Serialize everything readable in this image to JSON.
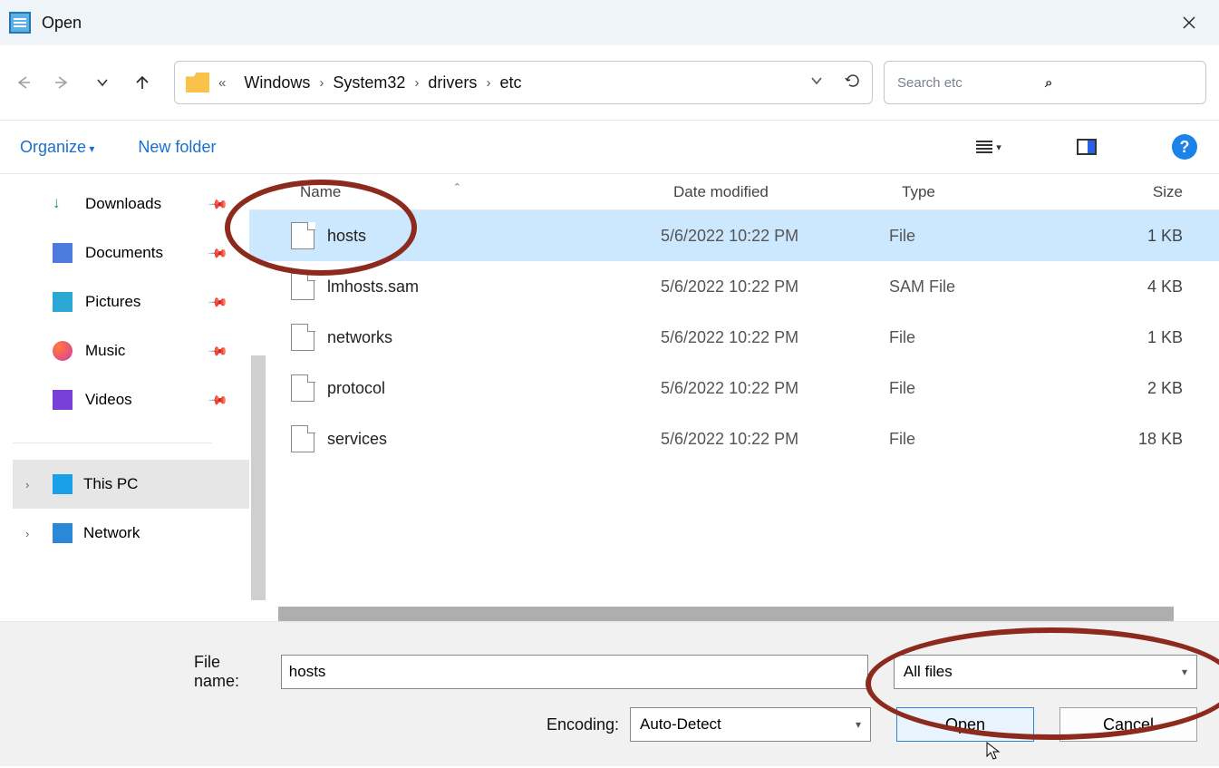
{
  "window": {
    "title": "Open"
  },
  "breadcrumbs": {
    "dots": "«",
    "items": [
      "Windows",
      "System32",
      "drivers",
      "etc"
    ]
  },
  "search": {
    "placeholder": "Search etc"
  },
  "cmdbar": {
    "organize": "Organize",
    "newfolder": "New folder"
  },
  "sidebar": {
    "quick": [
      {
        "label": "Downloads"
      },
      {
        "label": "Documents"
      },
      {
        "label": "Pictures"
      },
      {
        "label": "Music"
      },
      {
        "label": "Videos"
      }
    ],
    "tree": [
      {
        "label": "This PC",
        "selected": true
      },
      {
        "label": "Network",
        "selected": false
      }
    ]
  },
  "columns": {
    "name": "Name",
    "date": "Date modified",
    "type": "Type",
    "size": "Size"
  },
  "files": [
    {
      "name": "hosts",
      "date": "5/6/2022 10:22 PM",
      "type": "File",
      "size": "1 KB",
      "selected": true
    },
    {
      "name": "lmhosts.sam",
      "date": "5/6/2022 10:22 PM",
      "type": "SAM File",
      "size": "4 KB",
      "selected": false
    },
    {
      "name": "networks",
      "date": "5/6/2022 10:22 PM",
      "type": "File",
      "size": "1 KB",
      "selected": false
    },
    {
      "name": "protocol",
      "date": "5/6/2022 10:22 PM",
      "type": "File",
      "size": "2 KB",
      "selected": false
    },
    {
      "name": "services",
      "date": "5/6/2022 10:22 PM",
      "type": "File",
      "size": "18 KB",
      "selected": false
    }
  ],
  "footer": {
    "filename_label": "File name:",
    "filename_value": "hosts",
    "filter_label": "All files",
    "encoding_label": "Encoding:",
    "encoding_value": "Auto-Detect",
    "open": "Open",
    "cancel": "Cancel"
  }
}
